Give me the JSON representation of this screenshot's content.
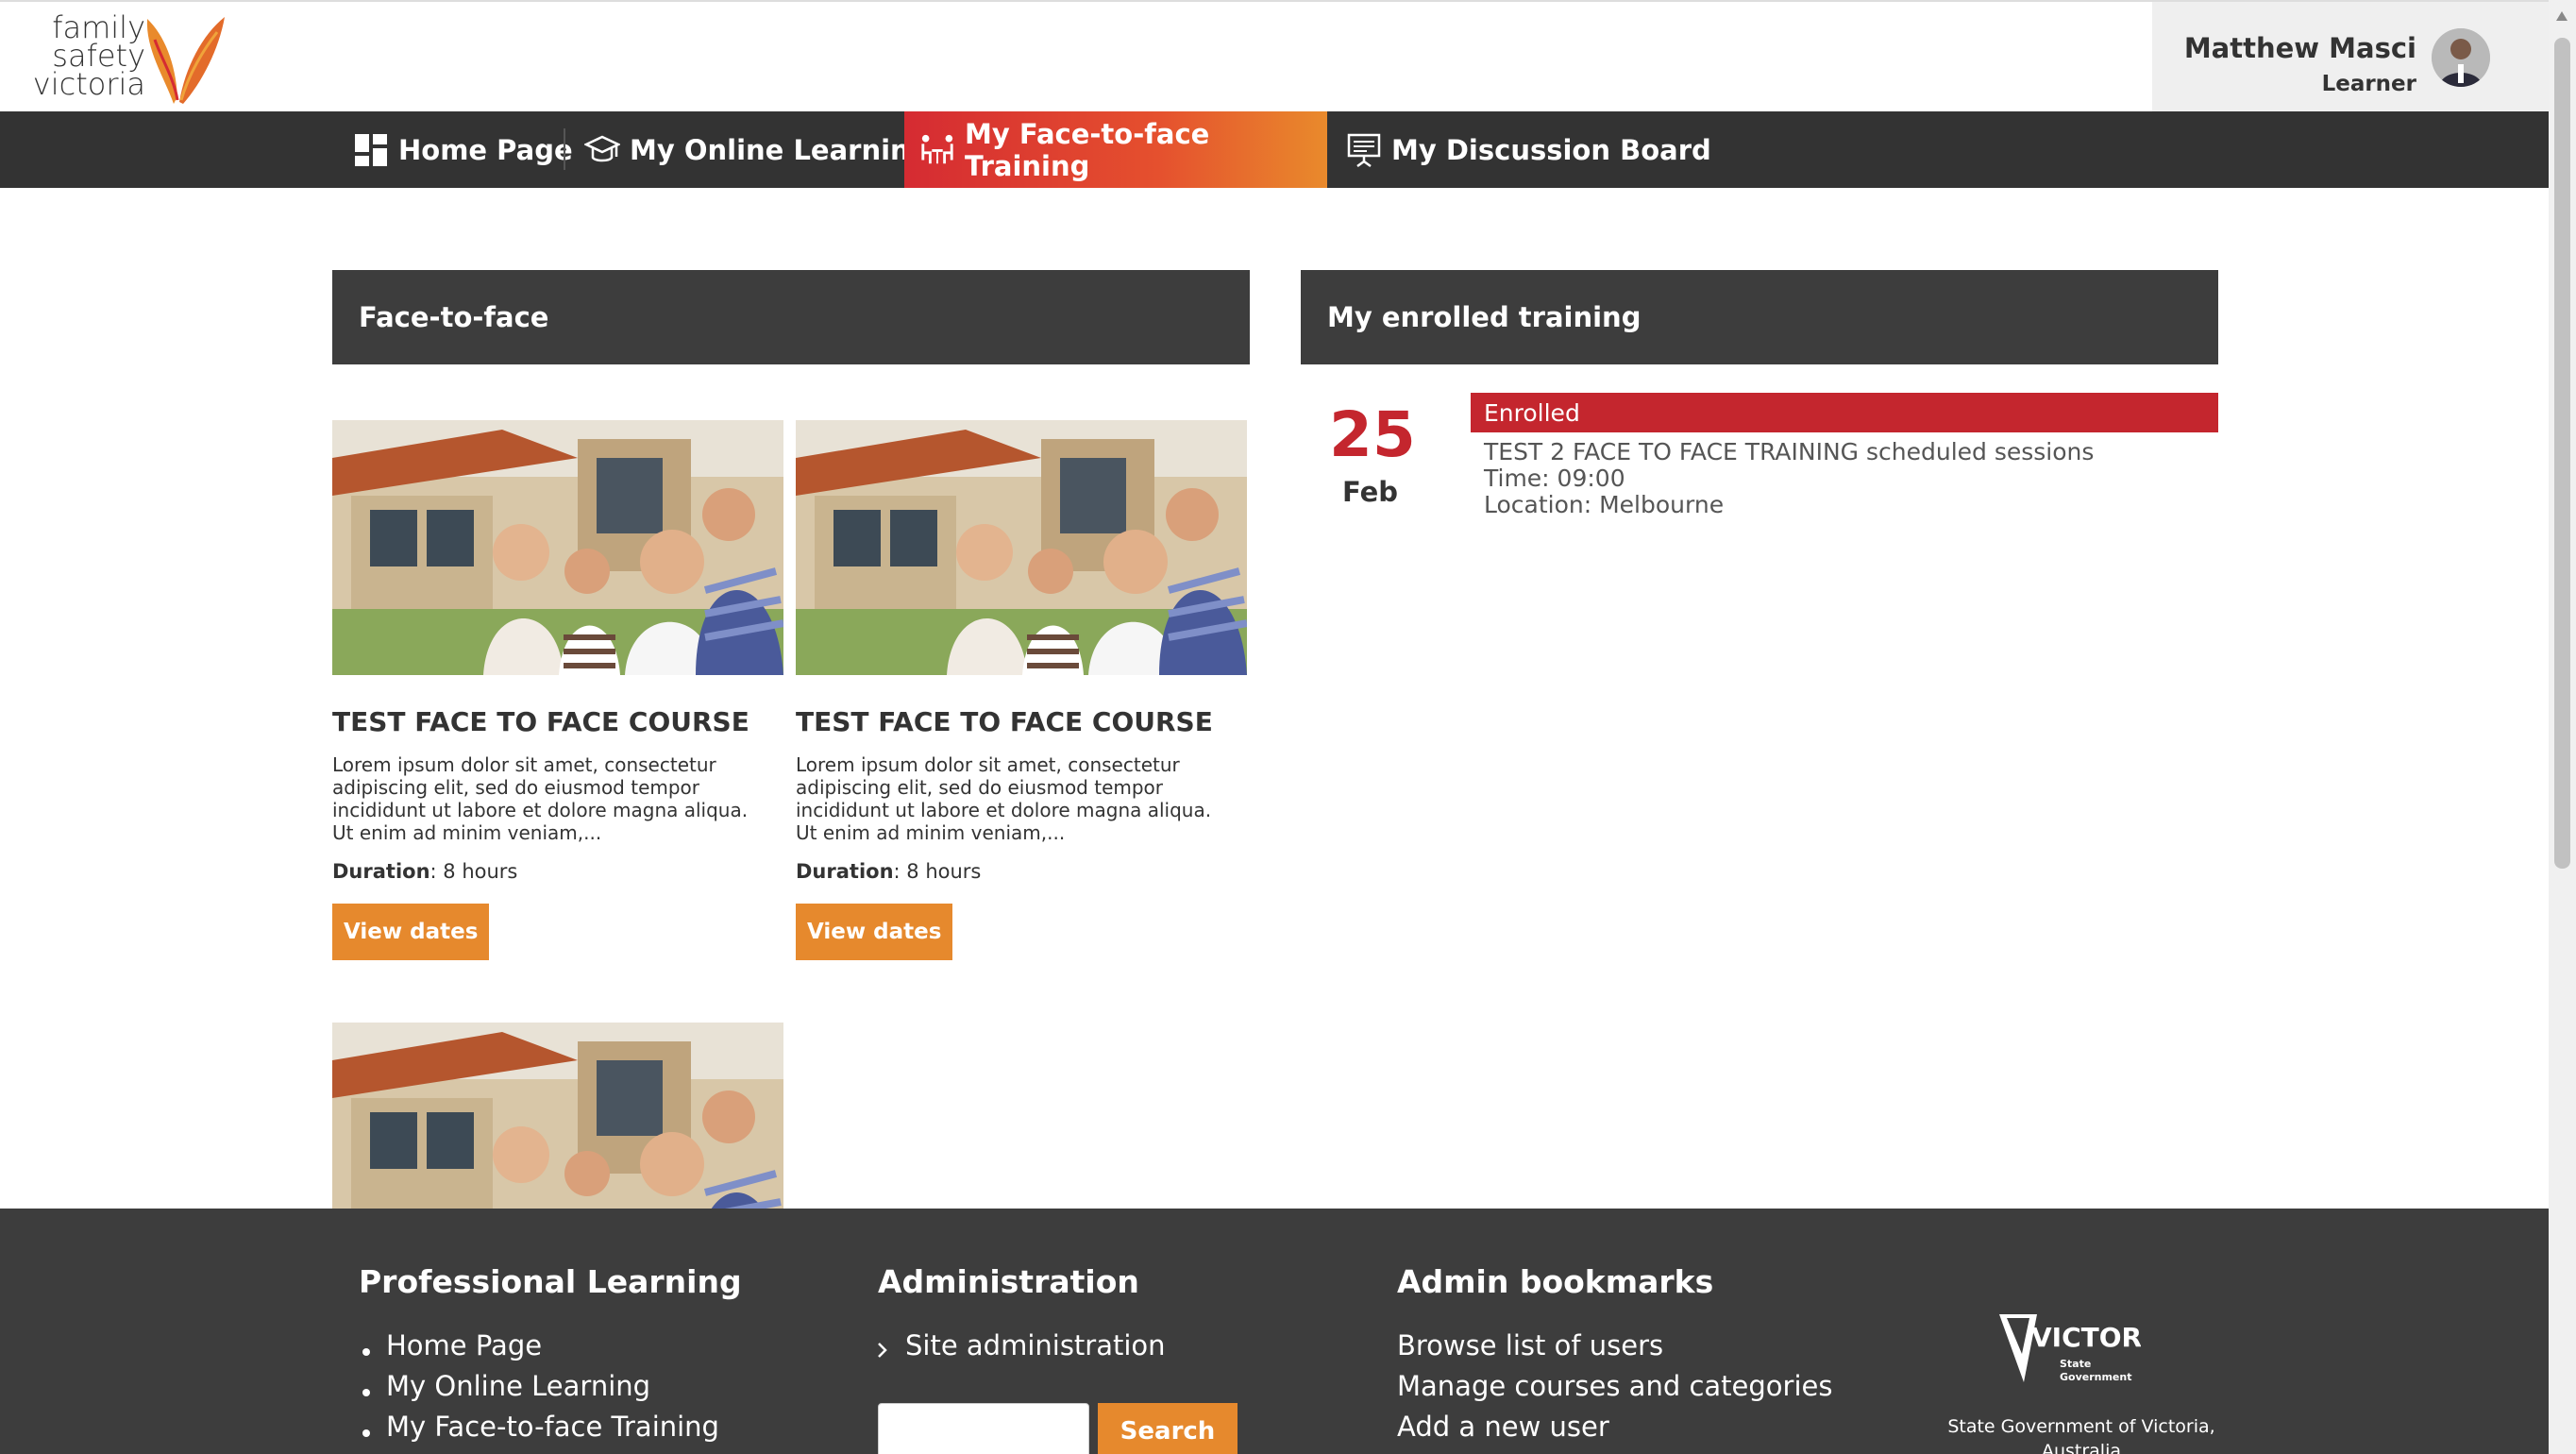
{
  "header": {
    "logo_lines": [
      "family",
      "safety",
      "victoria"
    ],
    "user_name": "Matthew Masci",
    "user_role": "Learner"
  },
  "nav": {
    "items": [
      {
        "label": "Home Page",
        "icon": "dashboard-icon"
      },
      {
        "label": "My Online Learning",
        "icon": "graduation-cap-icon"
      },
      {
        "label": "My Face-to-face Training",
        "icon": "people-table-icon"
      },
      {
        "label": "My Discussion Board",
        "icon": "presentation-board-icon"
      }
    ],
    "active_index": 2
  },
  "face_to_face": {
    "heading": "Face-to-face",
    "courses": [
      {
        "title": "TEST FACE TO FACE COURSE",
        "description_lines": [
          "Lorem ipsum dolor sit amet, consectetur",
          "adipiscing elit, sed do eiusmod tempor",
          "incididunt ut labore et dolore magna aliqua.",
          "Ut enim ad minim veniam,..."
        ],
        "duration_label": "Duration",
        "duration_value": ": 8 hours",
        "button": "View dates"
      },
      {
        "title": "TEST FACE TO FACE COURSE",
        "description_lines": [
          "Lorem ipsum dolor sit amet, consectetur",
          "adipiscing elit, sed do eiusmod tempor",
          "incididunt ut labore et dolore magna aliqua.",
          "Ut enim ad minim veniam,..."
        ],
        "duration_label": "Duration",
        "duration_value": ": 8 hours",
        "button": "View dates"
      }
    ]
  },
  "enrolled": {
    "heading": "My enrolled training",
    "day": "25",
    "month": "Feb",
    "status": "Enrolled",
    "title": "TEST 2 FACE TO FACE TRAINING scheduled sessions",
    "time": "Time: 09:00",
    "location": "Location: Melbourne"
  },
  "footer": {
    "col1": {
      "heading": "Professional Learning",
      "links": [
        "Home Page",
        "My Online Learning",
        "My Face-to-face Training"
      ]
    },
    "col2": {
      "heading": "Administration",
      "link": "Site administration",
      "search_button": "Search"
    },
    "col3": {
      "heading": "Admin bookmarks",
      "links": [
        "Browse list of users",
        "Manage courses and categories",
        "Add a new user"
      ]
    },
    "vic": {
      "brand": "VICTORIA",
      "sub1": "State",
      "sub2": "Government",
      "caption_line1": "State Government of Victoria,",
      "caption_line2": "Australia"
    }
  },
  "colors": {
    "nav_bg": "#333333",
    "active_start": "#d52b32",
    "active_end": "#e98a2c",
    "panel_head": "#3d3d3d",
    "accent_orange": "#e6892d",
    "enrolled_red": "#c4262e"
  }
}
